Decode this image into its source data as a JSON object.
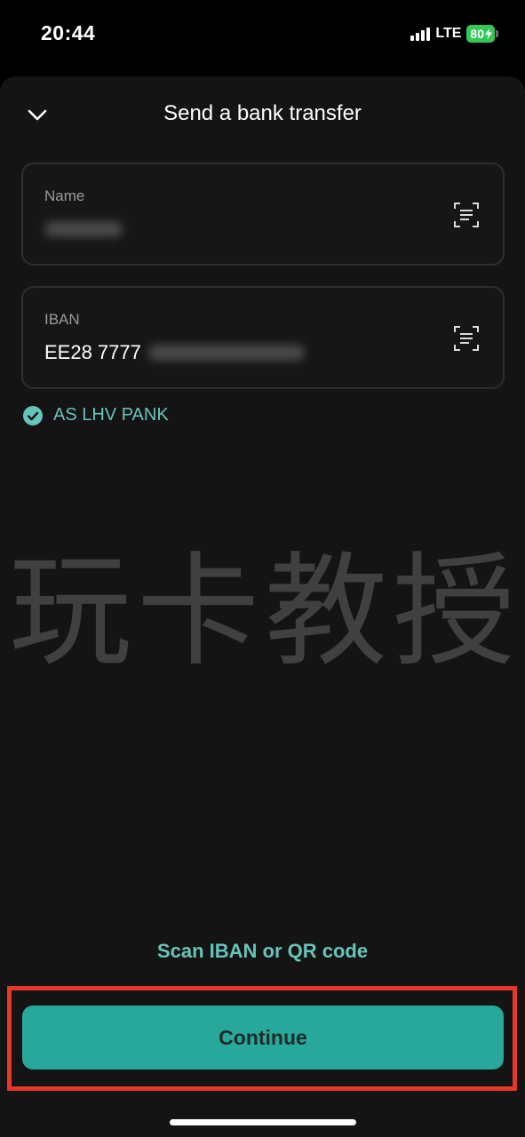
{
  "status_bar": {
    "time": "20:44",
    "network": "LTE",
    "battery": "80"
  },
  "header": {
    "title": "Send a bank transfer",
    "back_icon": "chevron-down-icon"
  },
  "fields": {
    "name": {
      "label": "Name",
      "value": "",
      "icon": "scan-document-icon"
    },
    "iban": {
      "label": "IBAN",
      "value_visible": "EE28 7777",
      "icon": "scan-document-icon"
    }
  },
  "bank": {
    "name": "AS LHV PANK",
    "icon": "check-circle-icon"
  },
  "watermark": "玩卡教授",
  "scan_link": "Scan IBAN or QR code",
  "continue_label": "Continue",
  "colors": {
    "accent": "#27a89a",
    "accent_text": "#67c4b9",
    "highlight": "#e8362a",
    "battery": "#34c759"
  }
}
